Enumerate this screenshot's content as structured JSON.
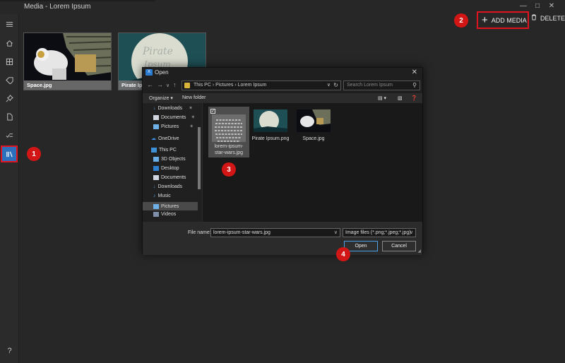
{
  "window": {
    "title": "Media - Lorem Ipsum"
  },
  "rail": {
    "items": [
      "menu-icon",
      "home-icon",
      "grid-icon",
      "tag-icon",
      "pin-icon",
      "document-icon",
      "checklist-icon",
      "library-icon",
      "help-icon"
    ]
  },
  "toolbar": {
    "add_label": "ADD MEDIA",
    "delete_label": "DELETE"
  },
  "tiles": [
    {
      "name": "Space.jpg"
    },
    {
      "name": "Pirate Ipsum"
    }
  ],
  "badges": [
    "1",
    "2",
    "3",
    "4"
  ],
  "dialog": {
    "title": "Open",
    "address": "This PC  ›  Pictures  ›  Lorem Ipsum",
    "search_placeholder": "Search Lorem Ipsum",
    "organize": "Organize ▾",
    "new_folder": "New folder",
    "tree": [
      "Downloads",
      "Documents",
      "Pictures",
      "OneDrive",
      "This PC",
      "3D Objects",
      "Desktop",
      "Documents",
      "Downloads",
      "Music",
      "Pictures",
      "Videos"
    ],
    "files": [
      "lorem-ipsum-star-wars.jpg",
      "Pirate Ipsum.png",
      "Space.jpg"
    ],
    "file_name_label": "File name:",
    "file_name_value": "lorem-ipsum-star-wars.jpg",
    "file_type_value": "Image files (*.png;*.jpeg;*.jpg)",
    "open_label": "Open",
    "cancel_label": "Cancel"
  },
  "colors": {
    "highlight": "#e0141e",
    "accent": "#2b6fbd",
    "badge": "#d21616"
  }
}
